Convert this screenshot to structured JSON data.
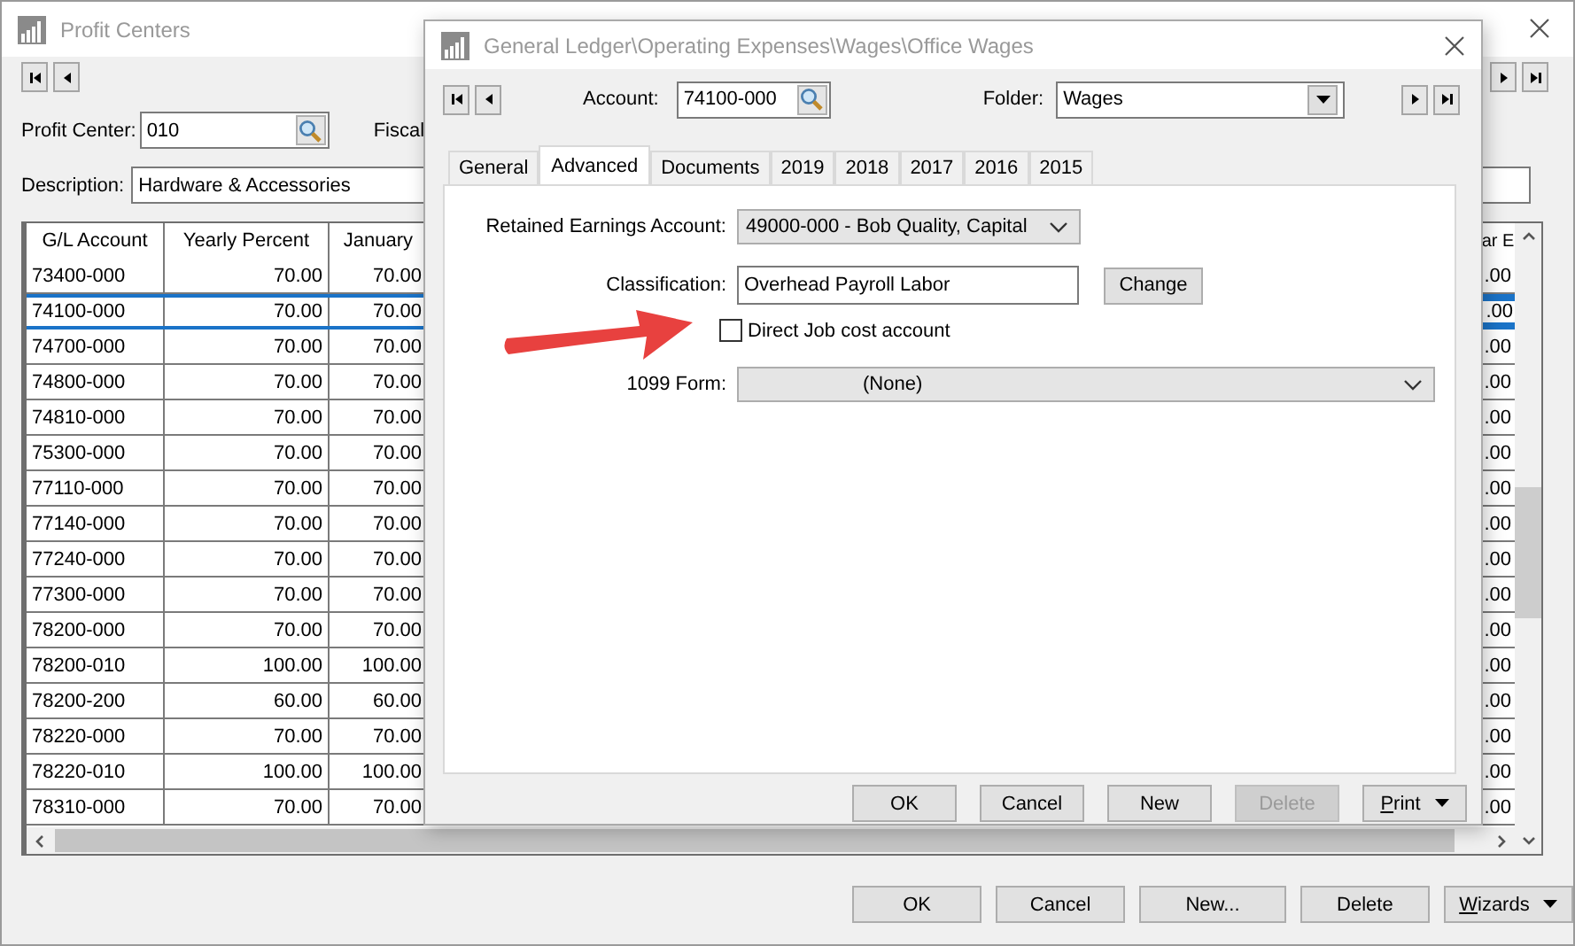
{
  "main_window": {
    "title": "Profit Centers",
    "profit_center": {
      "label": "Profit Center:",
      "value": "010"
    },
    "fiscal_label": "Fiscal",
    "description": {
      "label": "Description:",
      "value": "Hardware & Accessories"
    },
    "table": {
      "columns": [
        "G/L Account",
        "Yearly Percent",
        "January"
      ],
      "column_last": "ar E",
      "rows": [
        {
          "account": "73400-000",
          "yearly_percent": "70.00",
          "january": "70.00",
          "column_last": ".00",
          "selected": false
        },
        {
          "account": "74100-000",
          "yearly_percent": "70.00",
          "january": "70.00",
          "column_last": ".00",
          "selected": true
        },
        {
          "account": "74700-000",
          "yearly_percent": "70.00",
          "january": "70.00",
          "column_last": ".00",
          "selected": false
        },
        {
          "account": "74800-000",
          "yearly_percent": "70.00",
          "january": "70.00",
          "column_last": ".00",
          "selected": false
        },
        {
          "account": "74810-000",
          "yearly_percent": "70.00",
          "january": "70.00",
          "column_last": ".00",
          "selected": false
        },
        {
          "account": "75300-000",
          "yearly_percent": "70.00",
          "january": "70.00",
          "column_last": ".00",
          "selected": false
        },
        {
          "account": "77110-000",
          "yearly_percent": "70.00",
          "january": "70.00",
          "column_last": ".00",
          "selected": false
        },
        {
          "account": "77140-000",
          "yearly_percent": "70.00",
          "january": "70.00",
          "column_last": ".00",
          "selected": false
        },
        {
          "account": "77240-000",
          "yearly_percent": "70.00",
          "january": "70.00",
          "column_last": ".00",
          "selected": false
        },
        {
          "account": "77300-000",
          "yearly_percent": "70.00",
          "january": "70.00",
          "column_last": ".00",
          "selected": false
        },
        {
          "account": "78200-000",
          "yearly_percent": "70.00",
          "january": "70.00",
          "column_last": ".00",
          "selected": false
        },
        {
          "account": "78200-010",
          "yearly_percent": "100.00",
          "january": "100.00",
          "column_last": ".00",
          "selected": false
        },
        {
          "account": "78200-200",
          "yearly_percent": "60.00",
          "january": "60.00",
          "column_last": ".00",
          "selected": false
        },
        {
          "account": "78220-000",
          "yearly_percent": "70.00",
          "january": "70.00",
          "column_last": ".00",
          "selected": false
        },
        {
          "account": "78220-010",
          "yearly_percent": "100.00",
          "january": "100.00",
          "column_last": ".00",
          "selected": false
        },
        {
          "account": "78310-000",
          "yearly_percent": "70.00",
          "january": "70.00",
          "column_last": ".00",
          "selected": false
        }
      ]
    },
    "buttons": [
      {
        "label": "OK",
        "dropdown": false
      },
      {
        "label": "Cancel",
        "dropdown": false
      },
      {
        "label": "New...",
        "dropdown": false
      },
      {
        "label": "Delete",
        "dropdown": false
      },
      {
        "label": "Wizards",
        "dropdown": true
      }
    ]
  },
  "dialog": {
    "title": "General Ledger\\Operating Expenses\\Wages\\Office Wages",
    "account": {
      "label": "Account:",
      "value": "74100-000"
    },
    "folder": {
      "label": "Folder:",
      "value": "Wages"
    },
    "tabs": [
      {
        "label": "General",
        "selected": false
      },
      {
        "label": "Advanced",
        "selected": true
      },
      {
        "label": "Documents",
        "selected": false
      },
      {
        "label": "2019",
        "selected": false
      },
      {
        "label": "2018",
        "selected": false
      },
      {
        "label": "2017",
        "selected": false
      },
      {
        "label": "2016",
        "selected": false
      },
      {
        "label": "2015",
        "selected": false
      }
    ],
    "retained_earnings": {
      "label": "Retained Earnings Account:",
      "value": "49000-000 - Bob Quality, Capital"
    },
    "classification": {
      "label": "Classification:",
      "value": "Overhead Payroll Labor",
      "button": "Change"
    },
    "direct_job_cost": {
      "label": "Direct Job cost account",
      "checked": false
    },
    "form_1099": {
      "label": "1099 Form:",
      "value": "(None)"
    },
    "buttons": [
      {
        "label": "OK",
        "disabled": false,
        "dropdown": false
      },
      {
        "label": "Cancel",
        "disabled": false,
        "dropdown": false
      },
      {
        "label": "New",
        "disabled": false,
        "dropdown": false
      },
      {
        "label": "Delete",
        "disabled": true,
        "dropdown": false
      },
      {
        "label": "Print",
        "disabled": false,
        "dropdown": true
      }
    ]
  }
}
